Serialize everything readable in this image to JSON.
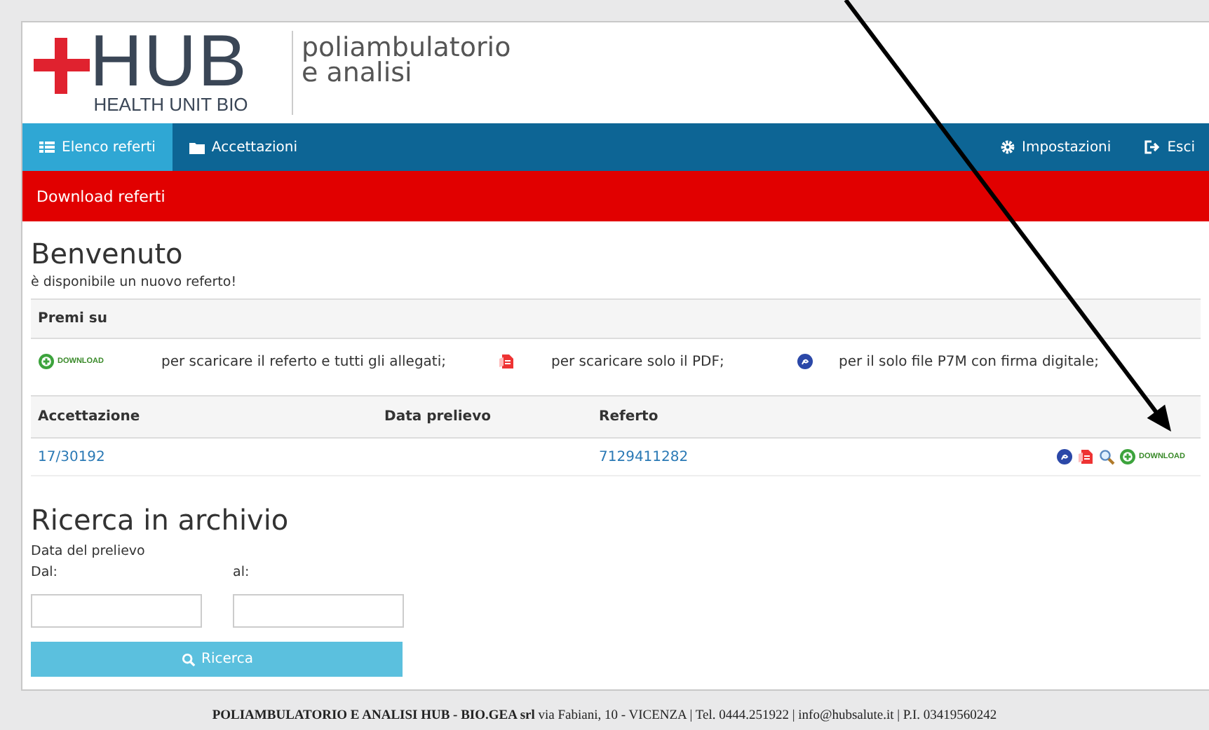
{
  "logo": {
    "name": "HUB",
    "subtitle": "HEALTH UNIT BIO",
    "tagline": [
      "poliambulatorio",
      "e analisi"
    ]
  },
  "nav": {
    "left": [
      {
        "kind": "list",
        "label": "Elenco referti",
        "selected": true
      },
      {
        "kind": "folder",
        "label": "Accettazioni",
        "selected": false
      }
    ],
    "right": [
      {
        "kind": "gear",
        "label": "Impostazioni"
      },
      {
        "kind": "exit",
        "label": "Esci"
      }
    ]
  },
  "page_bar": {
    "title": "Download referti"
  },
  "welcome": {
    "title": "Benvenuto",
    "message": "è disponibile un nuovo referto!"
  },
  "legend": {
    "heading": "Premi su",
    "items": [
      {
        "kind": "download",
        "icon_label": "DOWNLOAD",
        "text": "per scaricare il referto e tutti gli allegati;"
      },
      {
        "kind": "pdf",
        "text": "per scaricare solo il PDF;"
      },
      {
        "kind": "p7m",
        "text": "per il solo file P7M con firma digitale;"
      }
    ]
  },
  "table": {
    "columns": [
      "Accettazione",
      "Data prelievo",
      "Referto"
    ],
    "rows": [
      {
        "accettazione": "17/30192",
        "referto": "7129411282",
        "actions": [
          {
            "kind": "p7m"
          },
          {
            "kind": "pdf"
          },
          {
            "kind": "view"
          },
          {
            "kind": "download",
            "label": "DOWNLOAD"
          }
        ]
      }
    ]
  },
  "search": {
    "title": "Ricerca in archivio",
    "subtitle": "Data del prelievo",
    "from_label": "Dal:",
    "to_label": "al:",
    "button": "Ricerca"
  },
  "footer": {
    "text": "**POLIAMBULATORIO E ANALISI HUB - BIO.GEA srl** via Fabiani, 10 - VICENZA | Tel. 0444.251922 | info@hubsalute.it | P.I. 03419560242"
  }
}
